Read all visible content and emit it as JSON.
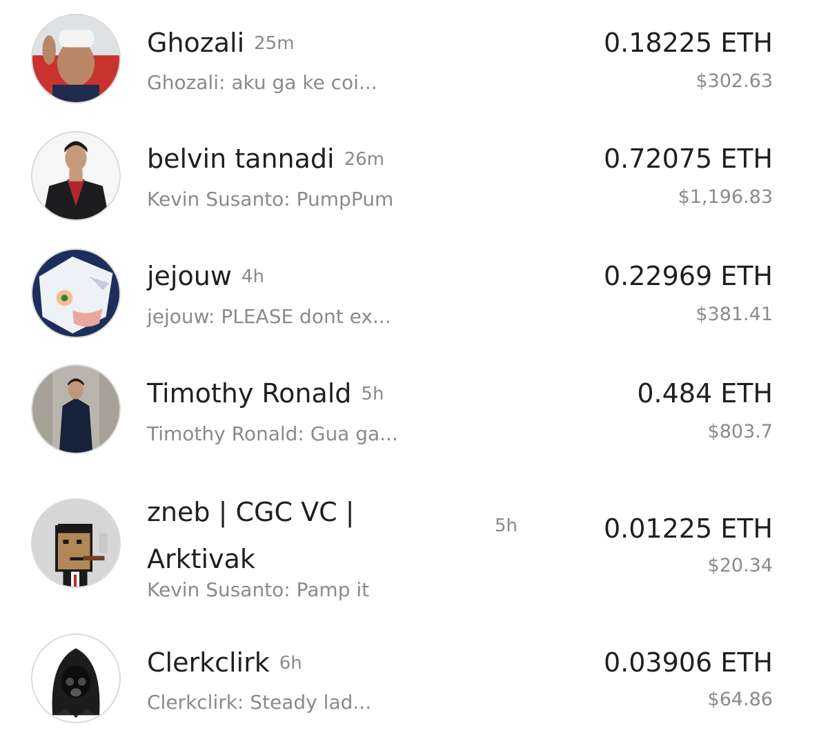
{
  "conversations": [
    {
      "name": "Ghozali",
      "time": "25m",
      "preview": "Ghozali: aku ga ke coi...",
      "eth": "0.18225 ETH",
      "usd": "$302.63",
      "avatar": "person-vr-headset-icon"
    },
    {
      "name": "belvin tannadi",
      "time": "26m",
      "preview": "Kevin Susanto: PumpPum",
      "eth": "0.72075 ETH",
      "usd": "$1,196.83",
      "avatar": "person-suit-icon"
    },
    {
      "name": "jejouw",
      "time": "4h",
      "preview": "jejouw: PLEASE dont ex...",
      "eth": "0.22969 ETH",
      "usd": "$381.41",
      "avatar": "anime-wolf-icon"
    },
    {
      "name": "Timothy Ronald",
      "time": "5h",
      "preview": "Timothy Ronald: Gua ga...",
      "eth": "0.484 ETH",
      "usd": "$803.7",
      "avatar": "person-coat-icon"
    },
    {
      "name_line1": "zneb | CGC VC |",
      "name_line2": "Arktivak",
      "time": "5h",
      "preview": "Kevin Susanto: Pamp it",
      "eth": "0.01225 ETH",
      "usd": "$20.34",
      "avatar": "pixel-punk-icon"
    },
    {
      "name": "Clerkclirk",
      "time": "6h",
      "preview": "Clerkclirk: Steady lad...",
      "eth": "0.03906 ETH",
      "usd": "$64.86",
      "avatar": "hooded-figure-icon"
    }
  ],
  "colors": {
    "primary_text": "#1f1f1f",
    "secondary_text": "#8a8a8a",
    "avatar_border": "#d9d9d9",
    "background": "#ffffff"
  }
}
